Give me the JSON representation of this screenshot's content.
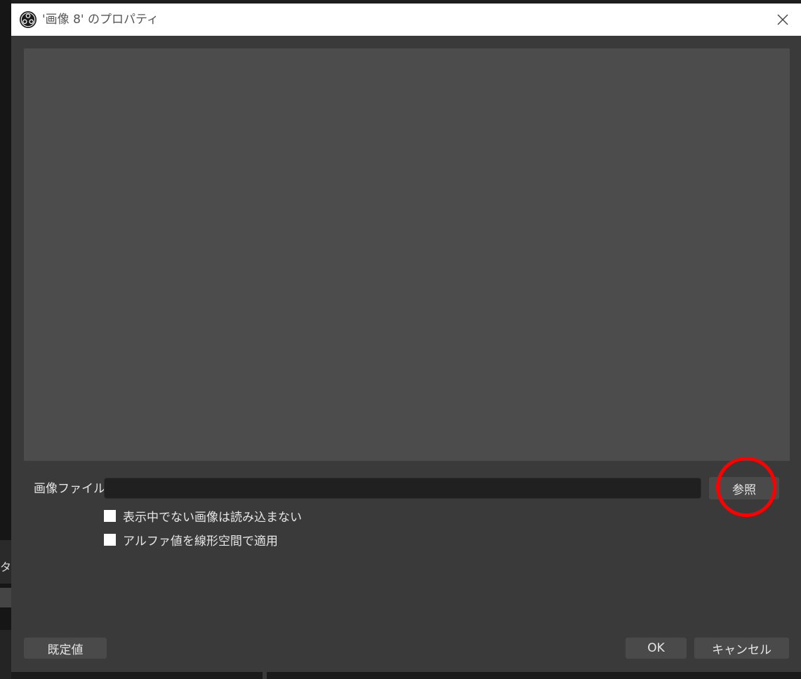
{
  "background_app": {
    "tab_fragment": "タ"
  },
  "dialog": {
    "title": "'画像 8' のプロパティ",
    "image_file_label": "画像ファイル",
    "image_file_value": "",
    "browse_label": "参照",
    "checkboxes": [
      {
        "label": "表示中でない画像は読み込まない",
        "checked": false
      },
      {
        "label": "アルファ値を線形空間で適用",
        "checked": false
      }
    ],
    "defaults_label": "既定値",
    "ok_label": "OK",
    "cancel_label": "キャンセル"
  },
  "annotation": {
    "color": "#ff0000",
    "target": "browse-button"
  },
  "colors": {
    "dialog_bg": "#3a3a3a",
    "preview_bg": "#4c4c4c",
    "input_bg": "#202020",
    "button_bg": "#4a4a4a",
    "text": "#e6e6e6"
  }
}
